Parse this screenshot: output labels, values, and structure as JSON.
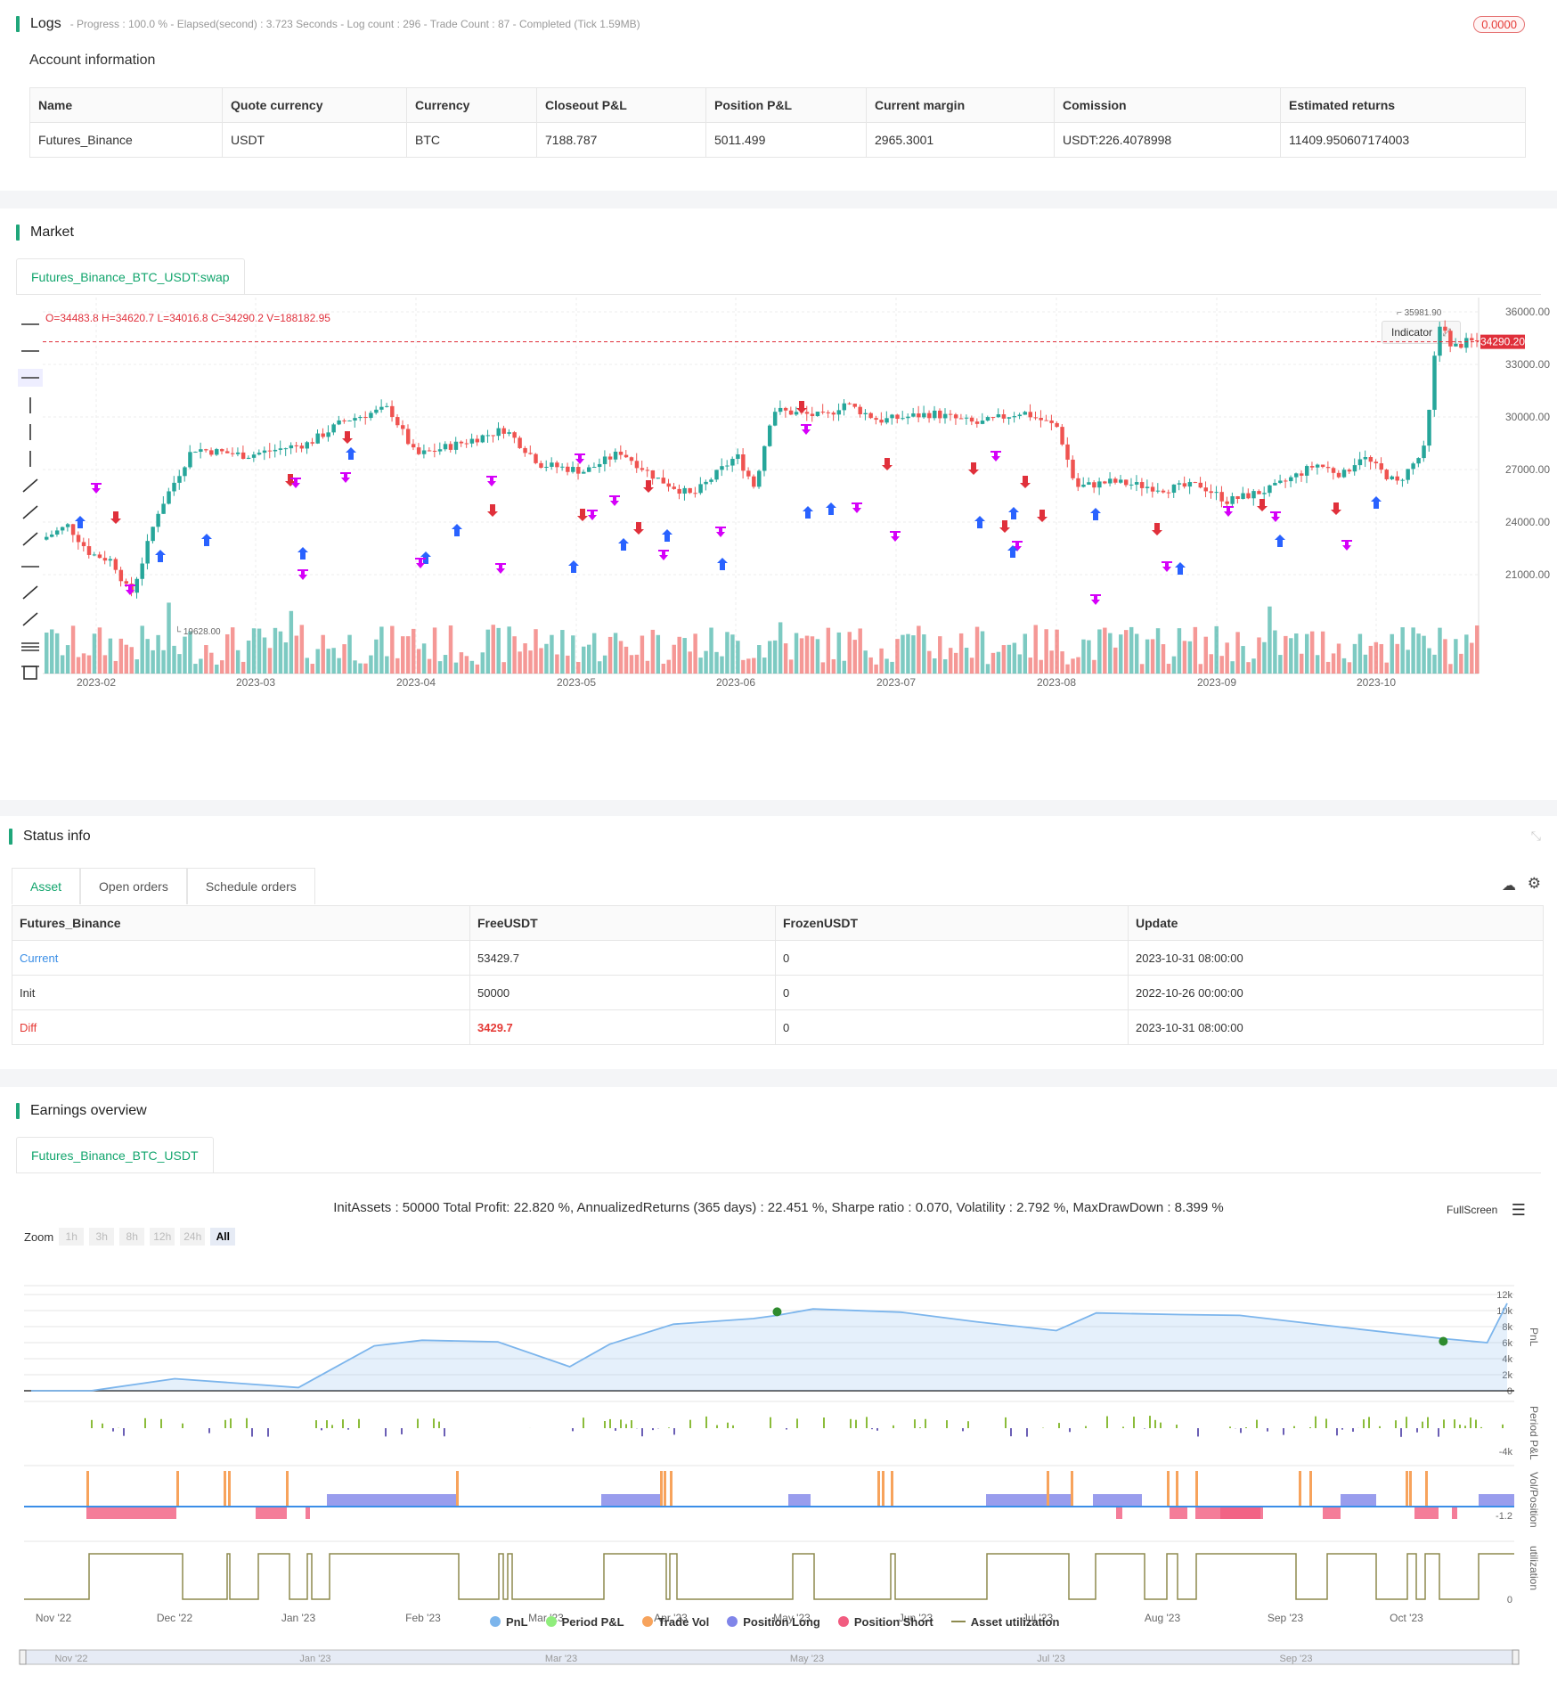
{
  "logs": {
    "title": "Logs",
    "summary": "- Progress : 100.0 % - Elapsed(second) : 3.723 Seconds - Log count : 296 - Trade Count : 87 - Completed (Tick 1.59MB)",
    "badge": "0.0000"
  },
  "account": {
    "title": "Account information",
    "headers": [
      "Name",
      "Quote currency",
      "Currency",
      "Closeout P&L",
      "Position P&L",
      "Current margin",
      "Comission",
      "Estimated returns"
    ],
    "row": [
      "Futures_Binance",
      "USDT",
      "BTC",
      "7188.787",
      "5011.499",
      "2965.3001",
      "USDT:226.4078998",
      "11409.950607174003"
    ]
  },
  "market": {
    "title": "Market",
    "tab": "Futures_Binance_BTC_USDT:swap",
    "ohlc": "O=34483.8 H=34620.7 L=34016.8 C=34290.2 V=188182.95",
    "indicator_button": "Indicator",
    "last_price": "34290.20",
    "high_label": "35981.90",
    "low_label": "19628.00",
    "y_ticks": [
      "36000.00",
      "33000.00",
      "30000.00",
      "27000.00",
      "24000.00",
      "21000.00"
    ],
    "x_ticks": [
      "2023-02",
      "2023-03",
      "2023-04",
      "2023-05",
      "2023-06",
      "2023-07",
      "2023-08",
      "2023-09",
      "2023-10"
    ],
    "colors": {
      "up": "#26a69a",
      "down": "#ef5350",
      "long": "#2962ff",
      "close": "#d500f9",
      "short": "#e0303b"
    }
  },
  "status": {
    "title": "Status info",
    "tabs": [
      "Asset",
      "Open orders",
      "Schedule orders"
    ],
    "headers": [
      "Futures_Binance",
      "FreeUSDT",
      "FrozenUSDT",
      "Update"
    ],
    "rows": [
      [
        "Current",
        "53429.7",
        "0",
        "2023-10-31 08:00:00"
      ],
      [
        "Init",
        "50000",
        "0",
        "2022-10-26 00:00:00"
      ],
      [
        "Diff",
        "3429.7",
        "0",
        "2023-10-31 08:00:00"
      ]
    ]
  },
  "earnings": {
    "title": "Earnings overview",
    "tab": "Futures_Binance_BTC_USDT",
    "summary": "InitAssets : 50000 Total Profit: 22.820 %, AnnualizedReturns (365 days) : 22.451 %, Sharpe ratio : 0.070, Volatility : 2.792 %, MaxDrawDown : 8.399 %",
    "fullscreen": "FullScreen",
    "zoom_label": "Zoom",
    "zoom_buttons": [
      "1h",
      "3h",
      "8h",
      "12h",
      "24h",
      "All"
    ],
    "pnl_ticks": [
      "12k",
      "10k",
      "8k",
      "6k",
      "4k",
      "2k",
      "0"
    ],
    "period_ticks": [
      "-4k"
    ],
    "vol_ticks": [
      "-1.2"
    ],
    "util_ticks": [
      "0"
    ],
    "axis_titles": [
      "PnL",
      "Period P&L",
      "Vol/Position",
      "utilization"
    ],
    "x_ticks": [
      "Nov '22",
      "Dec '22",
      "Jan '23",
      "Feb '23",
      "Mar '23",
      "Apr '23",
      "May '23",
      "Jun '23",
      "Jul '23",
      "Aug '23",
      "Sep '23",
      "Oct '23"
    ],
    "navigator_ticks": [
      "Nov '22",
      "Jan '23",
      "Mar '23",
      "May '23",
      "Jul '23",
      "Sep '23"
    ],
    "legend": [
      {
        "label": "PnL",
        "color": "#7cb5ec"
      },
      {
        "label": "Period P&L",
        "color": "#90ed7d"
      },
      {
        "label": "Trade Vol",
        "color": "#f7a35c"
      },
      {
        "label": "Position Long",
        "color": "#8085e9"
      },
      {
        "label": "Position Short",
        "color": "#f15c80"
      },
      {
        "label": "Asset utilization",
        "color": "#8d8a4e"
      }
    ]
  },
  "chart_data": {
    "type": "line",
    "title": "",
    "xlabel": "",
    "ylabel": "PnL",
    "x": [
      "2022-10-26",
      "2022-11-10",
      "2022-12-01",
      "2023-01-01",
      "2023-01-20",
      "2023-02-01",
      "2023-02-20",
      "2023-03-10",
      "2023-03-20",
      "2023-04-05",
      "2023-04-25",
      "2023-05-01",
      "2023-05-10",
      "2023-06-01",
      "2023-06-20",
      "2023-07-10",
      "2023-07-20",
      "2023-08-10",
      "2023-08-25",
      "2023-09-20",
      "2023-10-15",
      "2023-10-26",
      "2023-10-31"
    ],
    "values": [
      0,
      0,
      1500,
      400,
      5600,
      6300,
      6100,
      3000,
      5800,
      8300,
      9000,
      9400,
      10200,
      9800,
      8600,
      7500,
      9700,
      9500,
      9400,
      7900,
      6500,
      6000,
      10900
    ],
    "ylim": [
      0,
      12000
    ]
  }
}
